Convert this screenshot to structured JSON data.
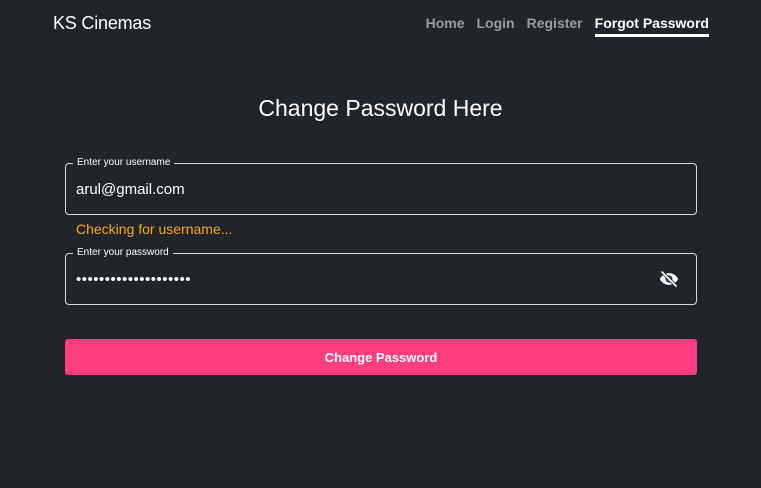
{
  "brand": "KS Cinemas",
  "nav": {
    "home": "Home",
    "login": "Login",
    "register": "Register",
    "forgot": "Forgot Password"
  },
  "page_title": "Change Password Here",
  "username_field": {
    "label": "Enter your username",
    "value": "arul@gmail.com"
  },
  "status_message": "Checking for username...",
  "password_field": {
    "label": "Enter your password",
    "value": "••••••••••••••••••••",
    "toggle_icon": "eye-slash-icon"
  },
  "submit_button": "Change Password",
  "colors": {
    "background": "#212529",
    "accent": "#ff3d7f",
    "warning": "#f5a623"
  }
}
